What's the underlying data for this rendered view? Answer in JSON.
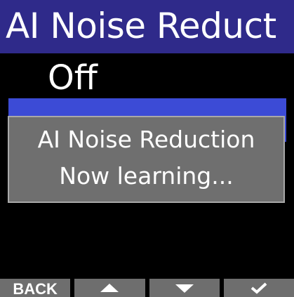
{
  "header": {
    "title": "AI Noise Reduct"
  },
  "menu": {
    "items": [
      {
        "label": "Off",
        "selected": false
      },
      {
        "label": "",
        "selected": true
      }
    ]
  },
  "dialog": {
    "line1": "AI Noise Reduction",
    "line2": "Now learning..."
  },
  "footer": {
    "back_label": "BACK",
    "up_icon": "triangle-up-icon",
    "down_icon": "triangle-down-icon",
    "confirm_icon": "checkmark-icon"
  },
  "colors": {
    "title_bar": "#2f2a8a",
    "selection": "#3c4bd6",
    "dialog_bg": "#6f6f6f",
    "dialog_border": "#a9a9a9",
    "footer_key": "#6e6e6e",
    "text": "#ffffff",
    "background": "#000000"
  }
}
